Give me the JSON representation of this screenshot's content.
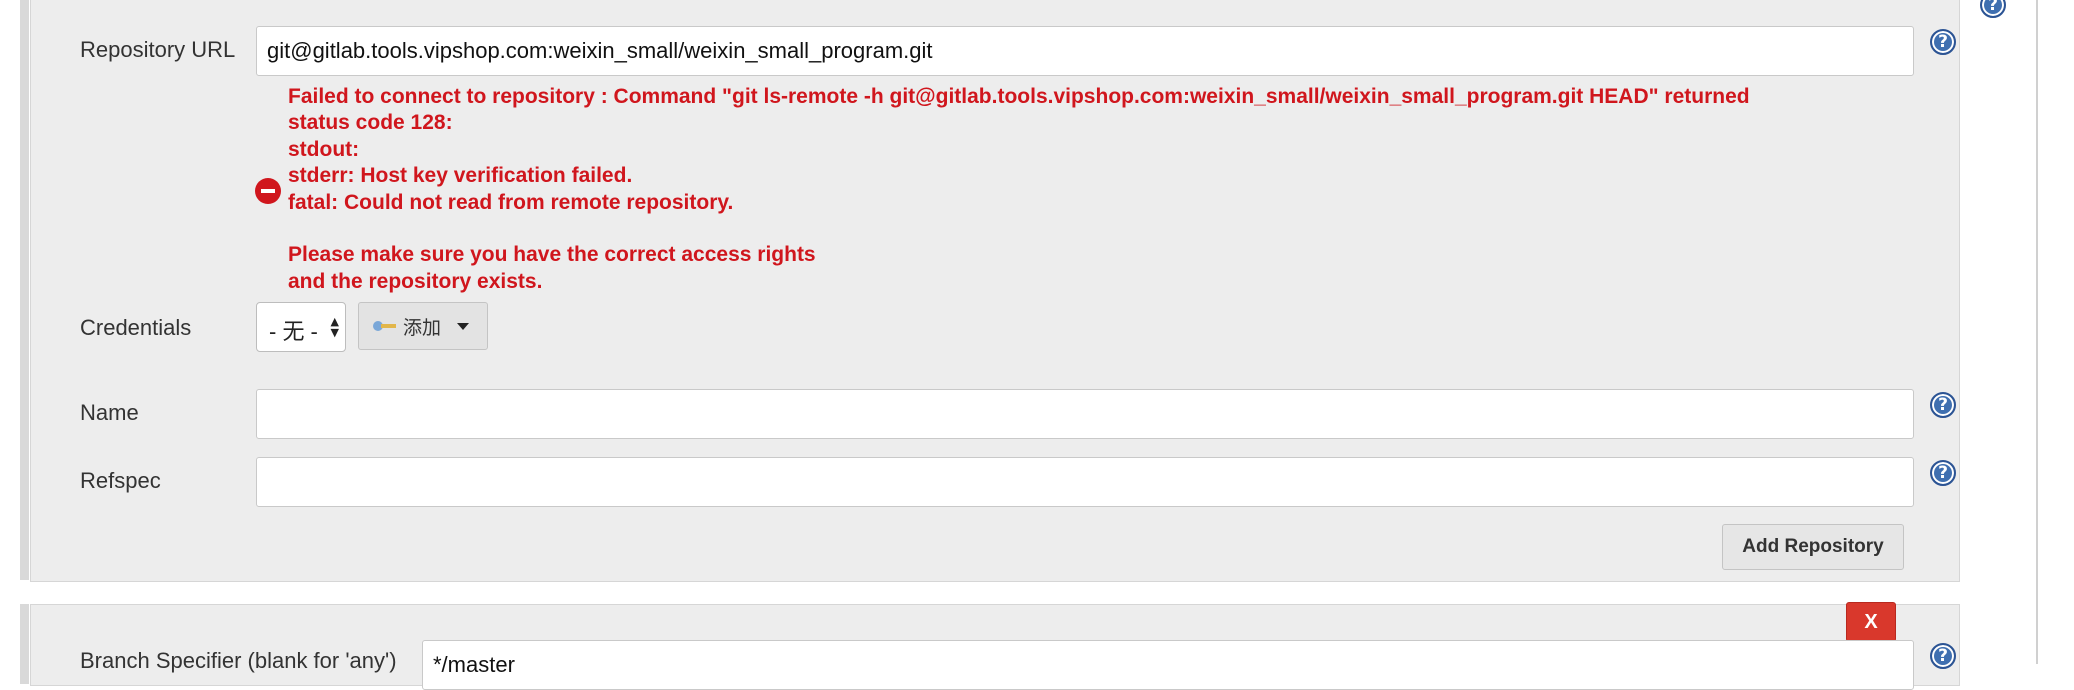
{
  "repository": {
    "url_label": "Repository URL",
    "url_value": "git@gitlab.tools.vipshop.com:weixin_small/weixin_small_program.git",
    "error_lines": [
      "Failed to connect to repository : Command \"git ls-remote -h git@gitlab.tools.vipshop.com:weixin_small/weixin_small_program.git HEAD\" returned",
      "status code 128:",
      "stdout:",
      "stderr: Host key verification failed.",
      "fatal: Could not read from remote repository.",
      "",
      "Please make sure you have the correct access rights",
      "and the repository exists."
    ],
    "credentials_label": "Credentials",
    "credentials_selected": "- 无 -",
    "add_button_label": "添加",
    "name_label": "Name",
    "name_value": "",
    "refspec_label": "Refspec",
    "refspec_value": "",
    "add_repository_label": "Add Repository"
  },
  "branch": {
    "label": "Branch Specifier (blank for 'any')",
    "value": "*/master",
    "delete_label": "X"
  },
  "help_glyph": "?",
  "colors": {
    "error": "#d0161d",
    "help": "#3f6fb0",
    "delete_button": "#d9382c",
    "panel": "#ededed"
  }
}
